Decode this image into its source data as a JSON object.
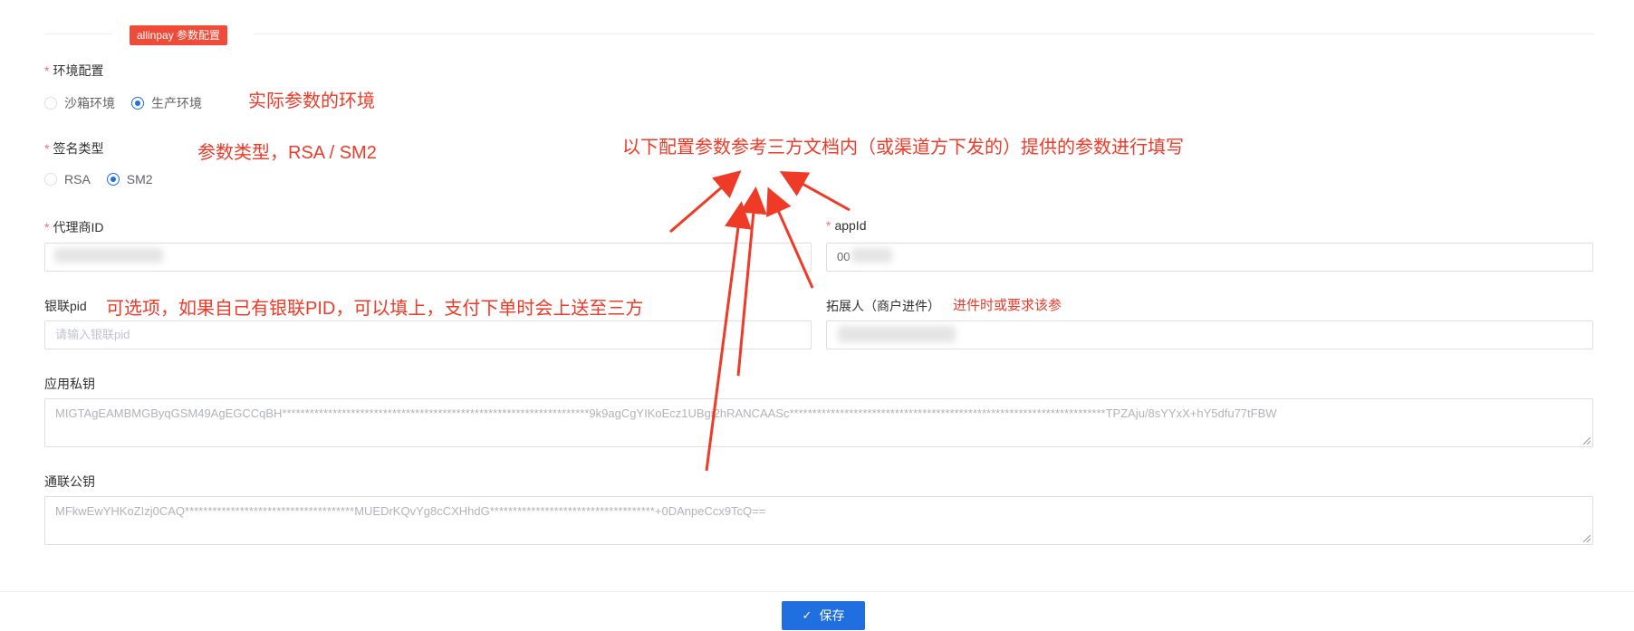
{
  "section": {
    "tag": "allinpay 参数配置"
  },
  "fields": {
    "env": {
      "label": "环境配置",
      "options": [
        "沙箱环境",
        "生产环境"
      ],
      "selected": "生产环境"
    },
    "sign_type": {
      "label": "签名类型",
      "options": [
        "RSA",
        "SM2"
      ],
      "selected": "SM2"
    },
    "agent_id": {
      "label": "代理商ID",
      "value": ""
    },
    "app_id": {
      "label": "appId",
      "value": "00"
    },
    "unionpay_pid": {
      "label": "银联pid",
      "placeholder": "请输入银联pid"
    },
    "expander": {
      "label": "拓展人（商户进件）",
      "value": ""
    },
    "private_key": {
      "label": "应用私钥",
      "value": "MIGTAgEAMBMGByqGSM49AgEGCCqBH*******************************************************************9k9agCgYIKoEcz1UBgi2hRANCAASc*********************************************************************TPZAju/8sYYxX+hY5dfu77tFBW"
    },
    "public_key": {
      "label": "通联公钥",
      "value": "MFkwEwYHKoZIzj0CAQ*************************************MUEDrKQvYg8cCXHhdG************************************+0DAnpeCcx9TcQ=="
    }
  },
  "annotations": {
    "env_note": "实际参数的环境",
    "sign_note": "参数类型，RSA / SM2",
    "main_note": "以下配置参数参考三方文档内（或渠道方下发的）提供的参数进行填写",
    "pid_note": "可选项，如果自己有银联PID，可以填上，支付下单时会上送至三方",
    "expander_note": "进件时或要求该参"
  },
  "footer": {
    "save_label": "保存"
  },
  "colors": {
    "primary": "#1f6fe0",
    "annotation": "#f03a28",
    "tag": "#f04a38",
    "required": "#f56c6c"
  },
  "icons": {
    "save": "check-icon"
  }
}
